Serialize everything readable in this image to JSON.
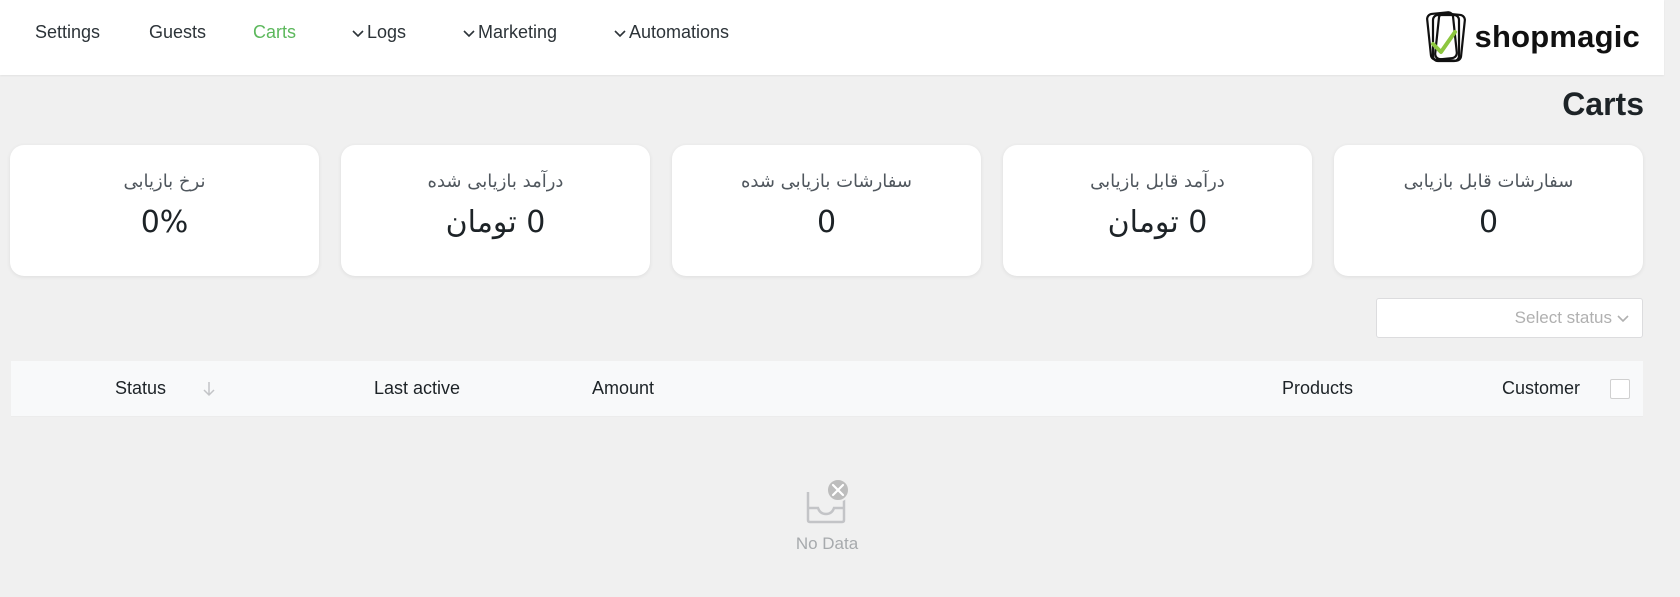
{
  "nav": {
    "items": [
      {
        "label": "Settings",
        "active": false,
        "dropdown": false
      },
      {
        "label": "Guests",
        "active": false,
        "dropdown": false
      },
      {
        "label": "Carts",
        "active": true,
        "dropdown": false
      },
      {
        "label": "Logs",
        "active": false,
        "dropdown": true
      },
      {
        "label": "Marketing",
        "active": false,
        "dropdown": true
      },
      {
        "label": "Automations",
        "active": false,
        "dropdown": true
      }
    ]
  },
  "brand": {
    "name": "shopmagic",
    "accent": "#8dc63f"
  },
  "page": {
    "title": "Carts"
  },
  "stats": [
    {
      "label": "سفارشات قابل بازیابی",
      "value": "0"
    },
    {
      "label": "درآمد قابل بازیابی",
      "value": "0 تومان"
    },
    {
      "label": "سفارشات بازیابی شده",
      "value": "0"
    },
    {
      "label": "درآمد بازیابی شده",
      "value": "0 تومان"
    },
    {
      "label": "نرخ بازیابی",
      "value": "0%"
    }
  ],
  "filter": {
    "placeholder": "Select status"
  },
  "table": {
    "columns": {
      "customer": "Customer",
      "products": "Products",
      "amount": "Amount",
      "last_active": "Last active",
      "status": "Status"
    },
    "rows": []
  },
  "empty": {
    "text": "No Data"
  },
  "colors": {
    "active_nav": "#5cb85c",
    "background": "#f0f0f0"
  }
}
